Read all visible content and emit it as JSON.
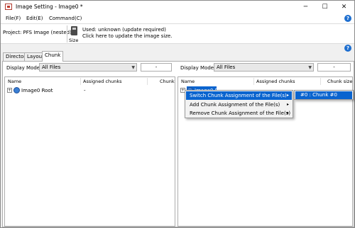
{
  "window": {
    "title": "Image Setting - Image0 *",
    "minimize": "─",
    "maximize": "☐",
    "close": "✕"
  },
  "menu": {
    "file": "File(F)",
    "edit": "Edit(E)",
    "command": "Command(C)",
    "help": "?"
  },
  "info": {
    "project": "Project: PFS Image (nested)",
    "size_label": "Size",
    "used": "Used: unknown (update required)",
    "update": "Click here to update the image size.",
    "help": "?"
  },
  "tabs": [
    {
      "label": "Directory",
      "active": false
    },
    {
      "label": "Layout",
      "active": false
    },
    {
      "label": "Chunk",
      "active": true
    }
  ],
  "left_pane": {
    "display_mode_label": "Display Mode:",
    "display_mode_value": "All Files",
    "filter_value": "-",
    "columns": [
      "Name",
      "Assigned chunks",
      "Chunk s"
    ],
    "row": {
      "expander": "+",
      "name": "Image0 Root",
      "assigned": "-"
    }
  },
  "right_pane": {
    "display_mode_label": "Display Mode:",
    "display_mode_value": "All Files",
    "filter_value": "-",
    "columns": [
      "Name",
      "Assigned chunks",
      "Chunk size"
    ],
    "row": {
      "expander": "+",
      "name": "Image0 Root"
    }
  },
  "context_menu": {
    "items": [
      {
        "label": "Switch Chunk Assignment of the File(s)",
        "highlighted": true
      },
      {
        "label": "Add Chunk Assignment of the File(s)",
        "highlighted": false
      },
      {
        "label": "Remove Chunk Assignment of the File(s)",
        "highlighted": false
      }
    ],
    "arrow": "▸"
  },
  "submenu": {
    "item": "#0 : Chunk #0"
  },
  "colors": {
    "selection": "#0a64cf",
    "help_icon": "#1e6fd0"
  }
}
